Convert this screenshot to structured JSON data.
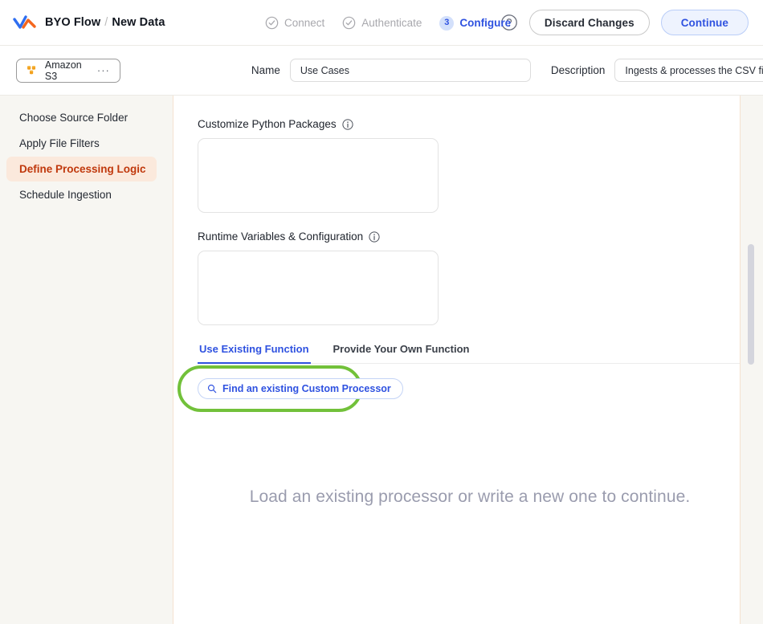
{
  "header": {
    "logo_icon": "wave-logo-icon",
    "breadcrumb_root": "BYO Flow",
    "breadcrumb_separator": "/",
    "breadcrumb_current": "New Data",
    "help_icon": "help-circle-icon",
    "discard_label": "Discard Changes",
    "continue_label": "Continue",
    "accent_blue": "#2f52e0",
    "accent_orange": "#c0380c",
    "highlight_green": "#72c13a"
  },
  "stepper": {
    "steps": [
      {
        "label": "Connect",
        "state": "done",
        "marker": "check-circle-icon"
      },
      {
        "label": "Authenticate",
        "state": "done",
        "marker": "check-circle-icon"
      },
      {
        "label": "Configure",
        "state": "active",
        "marker": "3"
      }
    ]
  },
  "metabar": {
    "source_chip": {
      "icon": "amazon-s3-icon",
      "label": "Amazon S3",
      "overflow": "···"
    },
    "name": {
      "label": "Name",
      "value": "Use Cases",
      "placeholder": "Name"
    },
    "description": {
      "label": "Description",
      "value": "Ingests & processes the CSV file",
      "placeholder": "Description"
    }
  },
  "sidebar": {
    "items": [
      {
        "label": "Choose Source Folder",
        "active": false
      },
      {
        "label": "Apply File Filters",
        "active": false
      },
      {
        "label": "Define Processing Logic",
        "active": true
      },
      {
        "label": "Schedule Ingestion",
        "active": false
      }
    ]
  },
  "main": {
    "packages": {
      "label": "Customize Python Packages",
      "info_icon": "info-circle-icon",
      "value": "",
      "placeholder": ""
    },
    "runtime": {
      "label": "Runtime Variables & Configuration",
      "info_icon": "info-circle-icon",
      "value": "",
      "placeholder": ""
    },
    "tabs": [
      {
        "label": "Use Existing Function",
        "active": true
      },
      {
        "label": "Provide Your Own Function",
        "active": false
      }
    ],
    "search_button": {
      "icon": "search-icon",
      "label": "Find an existing Custom Processor"
    },
    "empty_state": "Load an existing processor or write a new one to continue."
  },
  "scrollbar": {
    "name": "vertical-scrollbar"
  }
}
